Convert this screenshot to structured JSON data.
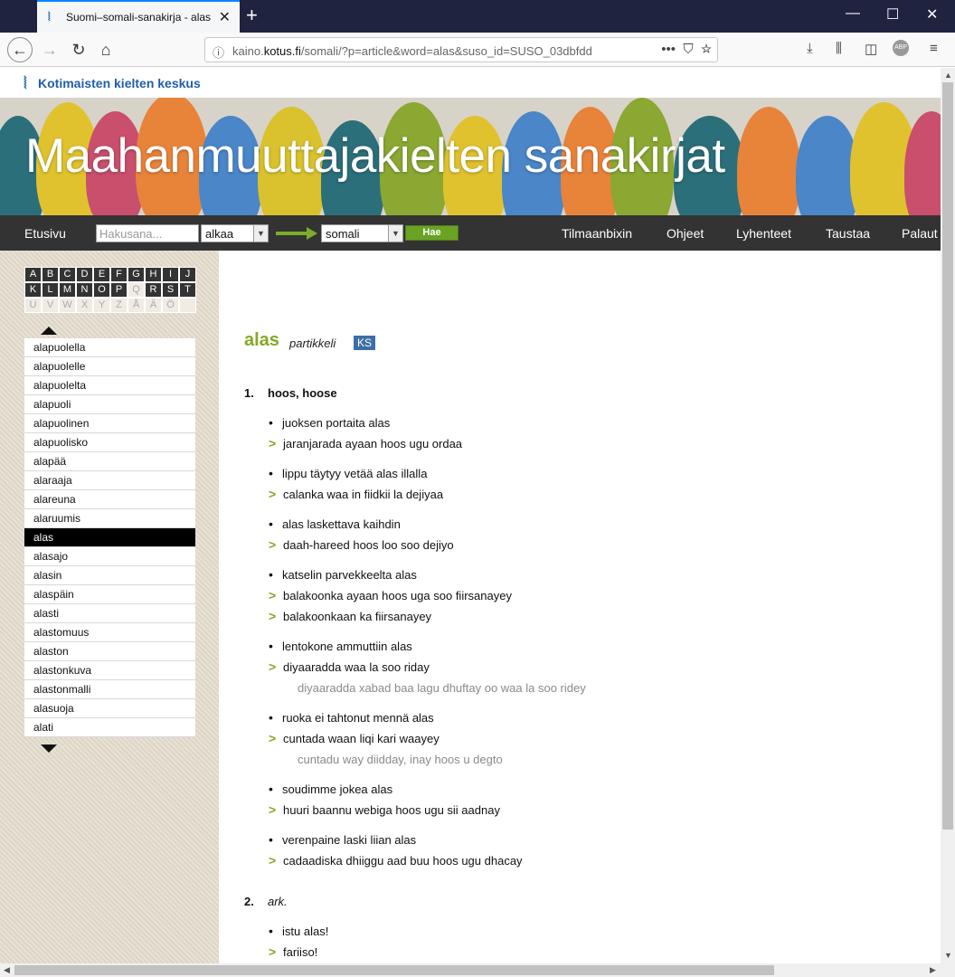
{
  "browser": {
    "tab_title": "Suomi–somali-sanakirja - alas",
    "url_prefix": "kaino.",
    "url_domain": "kotus.fi",
    "url_rest": "/somali/?p=article&word=alas&suso_id=SUSO_03dbfdd"
  },
  "site": {
    "logo_text": "Kotimaisten kielten keskus",
    "banner_title": "Maahanmuuttajakielten sanakirjat"
  },
  "menu": {
    "home": "Etusivu",
    "search_placeholder": "Hakusana...",
    "match_mode": "alkaa",
    "language": "somali",
    "search_button": "Hae",
    "links": [
      "Tilmaanbixin",
      "Ohjeet",
      "Lyhenteet",
      "Taustaa",
      "Palaut"
    ]
  },
  "alphabet": {
    "row1": [
      "A",
      "B",
      "C",
      "D",
      "E",
      "F",
      "G",
      "H",
      "I",
      "J"
    ],
    "row2": [
      "K",
      "L",
      "M",
      "N",
      "O",
      "P",
      "Q",
      "R",
      "S",
      "T"
    ],
    "row3": [
      "U",
      "V",
      "W",
      "X",
      "Y",
      "Z",
      "Å",
      "Ä",
      "Ö",
      ""
    ]
  },
  "wordlist": [
    "alapuolella",
    "alapuolelle",
    "alapuolelta",
    "alapuoli",
    "alapuolinen",
    "alapuolisko",
    "alapää",
    "alaraaja",
    "alareuna",
    "alaruumis",
    "alas",
    "alasajo",
    "alasin",
    "alaspäin",
    "alasti",
    "alastomuus",
    "alaston",
    "alastonkuva",
    "alastonmalli",
    "alasuoja",
    "alati"
  ],
  "active_word": "alas",
  "article": {
    "headword": "alas",
    "pos": "partikkeli",
    "badge": "KS",
    "senses": [
      {
        "num": "1.",
        "gloss": "hoos, hoose",
        "examples": [
          {
            "fi": "juoksen portaita alas",
            "tr": [
              "jaranjarada ayaan hoos ugu ordaa"
            ],
            "note": ""
          },
          {
            "fi": "lippu täytyy vetää alas illalla",
            "tr": [
              "calanka waa in fiidkii la dejiyaa"
            ],
            "note": ""
          },
          {
            "fi": "alas laskettava kaihdin",
            "tr": [
              "daah-hareed hoos loo soo dejiyo"
            ],
            "note": ""
          },
          {
            "fi": "katselin parvekkeelta alas",
            "tr": [
              "balakoonka ayaan hoos uga soo fiirsanayey",
              "balakoonkaan ka fiirsanayey"
            ],
            "note": ""
          },
          {
            "fi": "lentokone ammuttiin alas",
            "tr": [
              "diyaaradda waa la soo riday"
            ],
            "note": "diyaaradda xabad baa lagu dhuftay oo waa la soo ridey"
          },
          {
            "fi": "ruoka ei tahtonut mennä alas",
            "tr": [
              "cuntada waan liqi kari waayey"
            ],
            "note": "cuntadu way diidday, inay hoos u degto"
          },
          {
            "fi": "soudimme jokea alas",
            "tr": [
              "huuri baannu webiga hoos ugu sii aadnay"
            ],
            "note": ""
          },
          {
            "fi": "verenpaine laski liian alas",
            "tr": [
              "cadaadiska dhiiggu aad buu hoos ugu dhacay"
            ],
            "note": ""
          }
        ]
      },
      {
        "num": "2.",
        "gloss": "ark.",
        "examples": [
          {
            "fi": "istu alas!",
            "tr": [
              "fariiso!"
            ],
            "note": ""
          }
        ]
      }
    ]
  },
  "colors": {
    "accent_green": "#84a825",
    "menu_bg": "#333333",
    "badge_blue": "#3d6fa7",
    "logo_blue": "#1f5fa8"
  },
  "icons": [
    "back-arrow-icon",
    "forward-arrow-icon",
    "reload-icon",
    "home-icon",
    "info-icon",
    "more-icon",
    "pocket-icon",
    "star-icon",
    "download-icon",
    "library-icon",
    "sidebar-icon",
    "abp-icon",
    "hamburger-menu-icon"
  ]
}
